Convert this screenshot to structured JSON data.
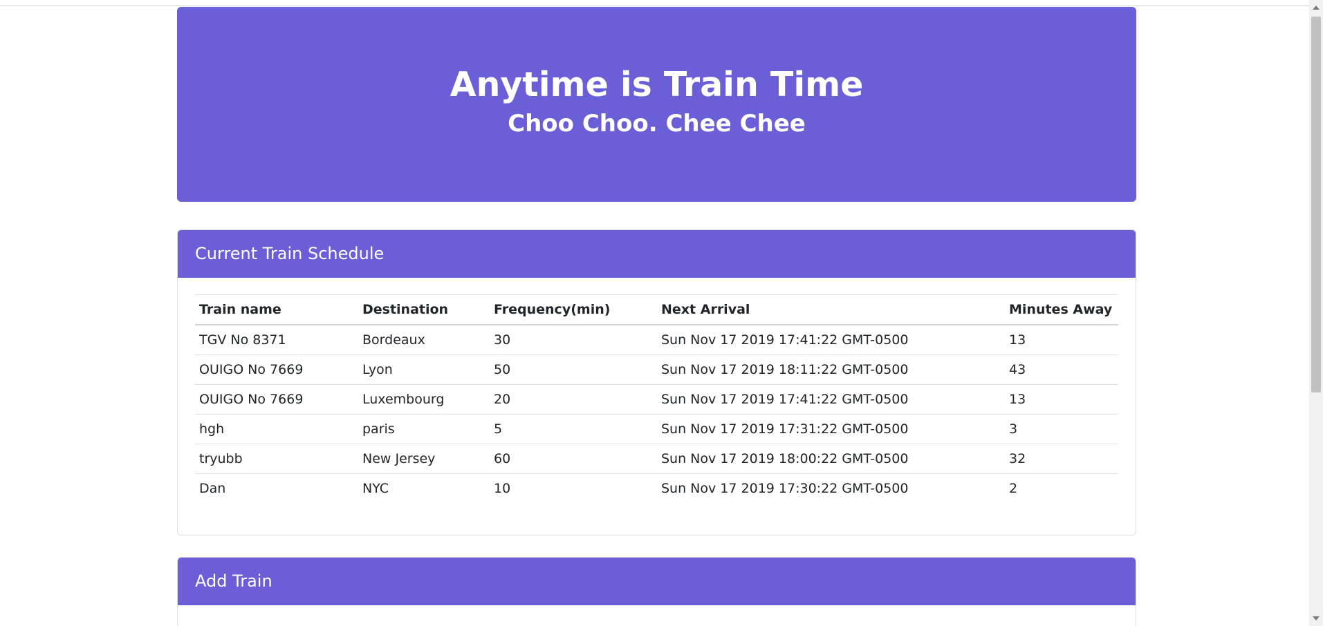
{
  "jumbotron": {
    "title": "Anytime is Train Time",
    "subtitle": "Choo Choo. Chee Chee"
  },
  "schedule": {
    "header": "Current Train Schedule",
    "columns": [
      "Train name",
      "Destination",
      "Frequency(min)",
      "Next Arrival",
      "Minutes Away"
    ],
    "rows": [
      [
        "TGV No 8371",
        "Bordeaux",
        "30",
        "Sun Nov 17 2019 17:41:22 GMT-0500",
        "13"
      ],
      [
        "OUIGO No 7669",
        "Lyon",
        "50",
        "Sun Nov 17 2019 18:11:22 GMT-0500",
        "43"
      ],
      [
        "OUIGO No 7669",
        "Luxembourg",
        "20",
        "Sun Nov 17 2019 17:41:22 GMT-0500",
        "13"
      ],
      [
        "hgh",
        "paris",
        "5",
        "Sun Nov 17 2019 17:31:22 GMT-0500",
        "3"
      ],
      [
        "tryubb",
        "New Jersey",
        "60",
        "Sun Nov 17 2019 18:00:22 GMT-0500",
        "32"
      ],
      [
        "Dan",
        "NYC",
        "10",
        "Sun Nov 17 2019 17:30:22 GMT-0500",
        "2"
      ]
    ]
  },
  "add_train": {
    "header": "Add Train"
  },
  "colors": {
    "accent": "#6a5fd6"
  }
}
